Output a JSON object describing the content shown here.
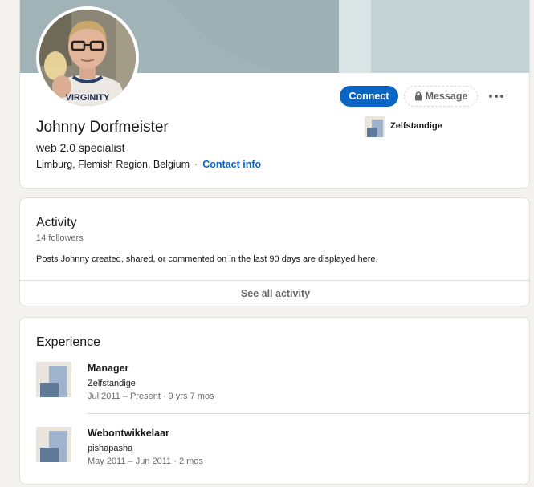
{
  "profile": {
    "name": "Johnny Dorfmeister",
    "headline": "web 2.0 specialist",
    "location": "Limburg, Flemish Region, Belgium",
    "separator": "·",
    "contact_info_label": "Contact info",
    "avatar_shirt_text": "VIRGINITY",
    "current_company": "Zelfstandige"
  },
  "actions": {
    "connect_label": "Connect",
    "message_label": "Message",
    "more_icon": "ellipsis-icon",
    "message_icon": "lock-icon"
  },
  "activity": {
    "title": "Activity",
    "followers": "14 followers",
    "description": "Posts Johnny created, shared, or commented on in the last 90 days are displayed here.",
    "see_all_label": "See all activity"
  },
  "experience": {
    "title": "Experience",
    "items": [
      {
        "title": "Manager",
        "company": "Zelfstandige",
        "dates": "Jul 2011 – Present · 9 yrs 7 mos"
      },
      {
        "title": "Webontwikkelaar",
        "company": "pishapasha",
        "dates": "May 2011 – Jun 2011 · 2 mos"
      }
    ]
  },
  "colors": {
    "page_bg": "#f3f2ef",
    "primary": "#0a66c2",
    "banner": "#a0b4b7",
    "logo_light": "#9fb4cc",
    "logo_dark": "#5f7a99",
    "logo_bg": "#e9e5dc"
  }
}
